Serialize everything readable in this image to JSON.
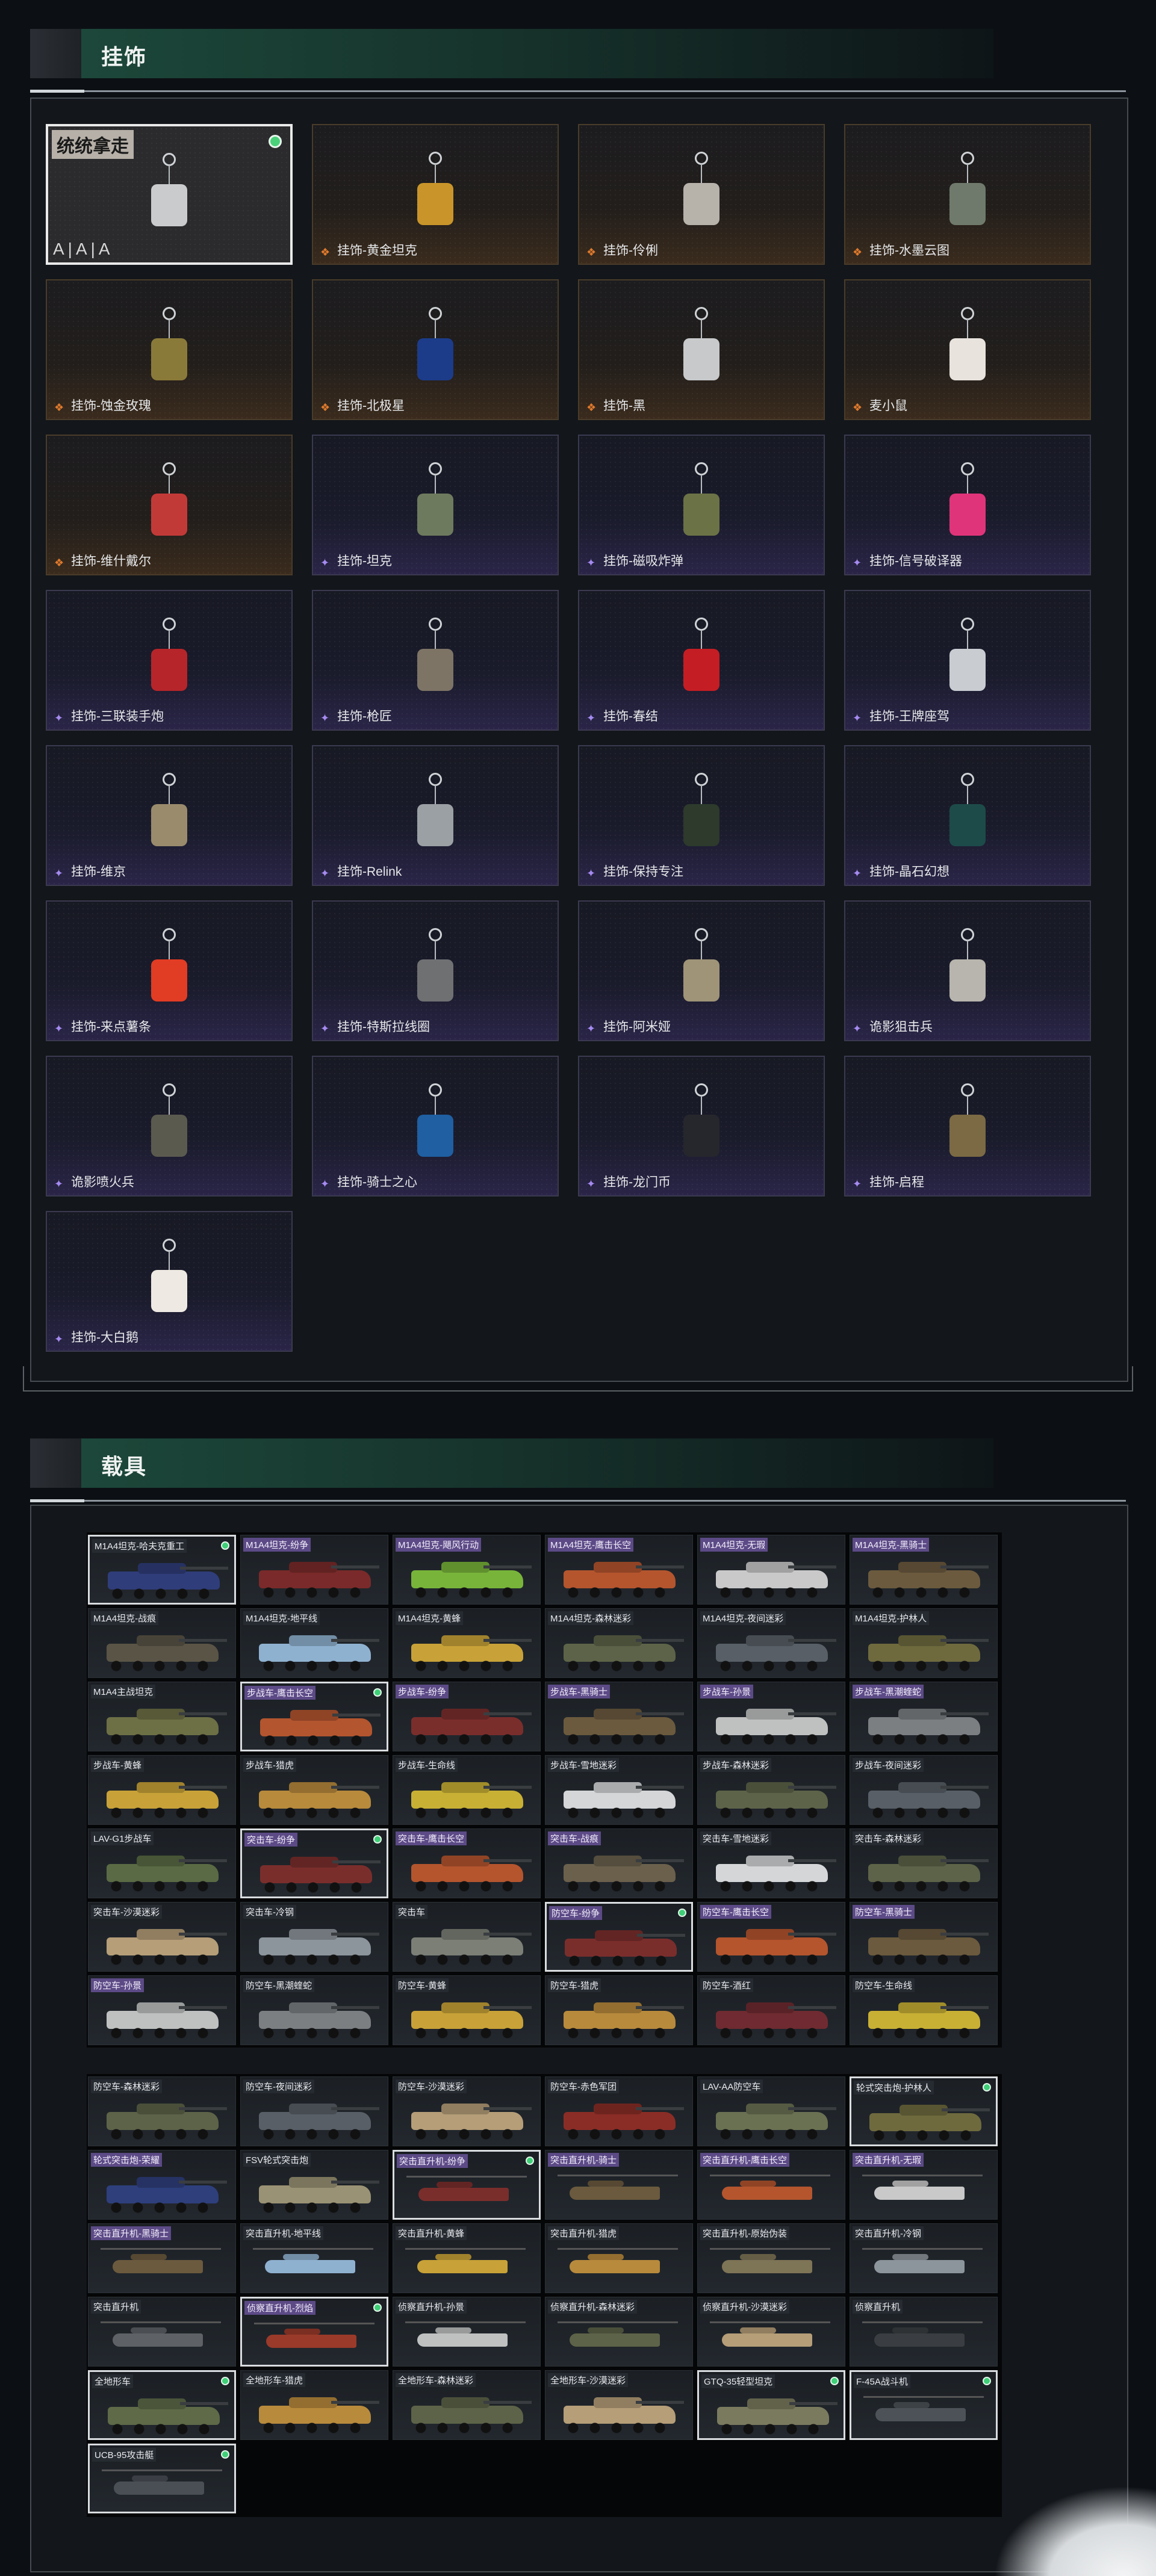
{
  "sections": {
    "charms": {
      "title": "挂饰",
      "items": [
        {
          "label": "统统拿走",
          "rarity": "selected",
          "badge": "统统拿走",
          "tier": "A|A|A",
          "owned": true,
          "color": "#c9cbcd"
        },
        {
          "label": "挂饰-黄金坦克",
          "rarity": "gold",
          "color": "#c9952a"
        },
        {
          "label": "挂饰-伶俐",
          "rarity": "gold",
          "color": "#b7b3ab"
        },
        {
          "label": "挂饰-水墨云图",
          "rarity": "gold",
          "color": "#6f7a6c"
        },
        {
          "label": "挂饰-蚀金玫瑰",
          "rarity": "gold",
          "color": "#8a7a3a"
        },
        {
          "label": "挂饰-北极星",
          "rarity": "gold",
          "color": "#1c3c8a"
        },
        {
          "label": "挂饰-黑",
          "rarity": "gold",
          "color": "#c7c9cb"
        },
        {
          "label": "麦小鼠",
          "rarity": "gold",
          "color": "#e9e3dd"
        },
        {
          "label": "挂饰-维什戴尔",
          "rarity": "gold",
          "color": "#c23a38"
        },
        {
          "label": "挂饰-坦克",
          "rarity": "purple",
          "color": "#6e7a5e"
        },
        {
          "label": "挂饰-磁吸炸弹",
          "rarity": "purple",
          "color": "#6b7246"
        },
        {
          "label": "挂饰-信号破译器",
          "rarity": "purple",
          "color": "#e0347a"
        },
        {
          "label": "挂饰-三联装手炮",
          "rarity": "purple",
          "color": "#b6252a"
        },
        {
          "label": "挂饰-枪匠",
          "rarity": "purple",
          "color": "#7d7466"
        },
        {
          "label": "挂饰-春结",
          "rarity": "purple",
          "color": "#c51d24"
        },
        {
          "label": "挂饰-王牌座驾",
          "rarity": "purple",
          "color": "#c9cdd2"
        },
        {
          "label": "挂饰-维京",
          "rarity": "purple",
          "color": "#9a8b6d"
        },
        {
          "label": "挂饰-Relink",
          "rarity": "purple",
          "color": "#9ba0a4"
        },
        {
          "label": "挂饰-保持专注",
          "rarity": "purple",
          "color": "#2d3a2c"
        },
        {
          "label": "挂饰-晶石幻想",
          "rarity": "purple",
          "color": "#1d4b4a"
        },
        {
          "label": "挂饰-来点薯条",
          "rarity": "purple",
          "color": "#e13c24"
        },
        {
          "label": "挂饰-特斯拉线圈",
          "rarity": "purple",
          "color": "#6f7072"
        },
        {
          "label": "挂饰-阿米娅",
          "rarity": "purple",
          "color": "#9f9478"
        },
        {
          "label": "诡影狙击兵",
          "rarity": "purple",
          "color": "#b8b5ae"
        },
        {
          "label": "诡影喷火兵",
          "rarity": "purple",
          "color": "#5b5a4f"
        },
        {
          "label": "挂饰-骑士之心",
          "rarity": "purple",
          "color": "#1f5fa2"
        },
        {
          "label": "挂饰-龙门币",
          "rarity": "purple",
          "color": "#25272c"
        },
        {
          "label": "挂饰-启程",
          "rarity": "purple",
          "color": "#7b6a44"
        },
        {
          "label": "挂饰-大白鹅",
          "rarity": "purple",
          "color": "#eee9e2"
        }
      ]
    },
    "vehicles": {
      "title": "载具",
      "group1": [
        {
          "label": "M1A4坦克-哈夫克重工",
          "hl": true,
          "dot": true,
          "color": "#2f3d7a",
          "tag": "dark"
        },
        {
          "label": "M1A4坦克-纷争",
          "color": "#7a2a2a",
          "tag": "purple"
        },
        {
          "label": "M1A4坦克-飓风行动",
          "color": "#78b43a",
          "tag": "purple"
        },
        {
          "label": "M1A4坦克-鹰击长空",
          "color": "#b4552e",
          "tag": "purple"
        },
        {
          "label": "M1A4坦克-无瑕",
          "color": "#c9c9c9",
          "tag": "purple"
        },
        {
          "label": "M1A4坦克-黑骑士",
          "color": "#6b5a3e",
          "tag": "purple"
        },
        {
          "label": "M1A4坦克-战痕",
          "color": "#5a5446",
          "tag": "dark"
        },
        {
          "label": "M1A4坦克-地平线",
          "color": "#8fb1d0",
          "tag": "dark"
        },
        {
          "label": "M1A4坦克-黄蜂",
          "color": "#c8a238",
          "tag": "dark"
        },
        {
          "label": "M1A4坦克-森林迷彩",
          "color": "#5d6348",
          "tag": "dark"
        },
        {
          "label": "M1A4坦克-夜间迷彩",
          "color": "#585f66",
          "tag": "dark"
        },
        {
          "label": "M1A4坦克-护林人",
          "color": "#6e6a3e",
          "tag": "dark"
        },
        {
          "label": "M1A4主战坦克",
          "color": "#6d6f45",
          "tag": "dark"
        },
        {
          "label": "步战车-鹰击长空",
          "hl": true,
          "dot": true,
          "color": "#b3552f",
          "tag": "purple"
        },
        {
          "label": "步战车-纷争",
          "color": "#7a2e2c",
          "tag": "purple"
        },
        {
          "label": "步战车-黑骑士",
          "color": "#6b5a3e",
          "tag": "purple"
        },
        {
          "label": "步战车-孙景",
          "color": "#bfc1c0",
          "tag": "purple"
        },
        {
          "label": "步战车-黑潮蝰蛇",
          "color": "#7c7f82",
          "tag": "purple"
        },
        {
          "label": "步战车-黄蜂",
          "color": "#c8a238",
          "tag": "dark"
        },
        {
          "label": "步战车-猎虎",
          "color": "#b88a3c",
          "tag": "dark"
        },
        {
          "label": "步战车-生命线",
          "color": "#c8b034",
          "tag": "dark"
        },
        {
          "label": "步战车-雪地迷彩",
          "color": "#d4d6d8",
          "tag": "dark"
        },
        {
          "label": "步战车-森林迷彩",
          "color": "#5d6348",
          "tag": "dark"
        },
        {
          "label": "步战车-夜间迷彩",
          "color": "#585f66",
          "tag": "dark"
        },
        {
          "label": "LAV-G1步战车",
          "color": "#5a6a44",
          "tag": "dark"
        },
        {
          "label": "突击车-纷争",
          "hl": true,
          "dot": true,
          "color": "#7a2e2c",
          "tag": "purple"
        },
        {
          "label": "突击车-鹰击长空",
          "color": "#b4552e",
          "tag": "purple"
        },
        {
          "label": "突击车-战痕",
          "color": "#6a604c",
          "tag": "purple"
        },
        {
          "label": "突击车-雪地迷彩",
          "color": "#d4d6d8",
          "tag": "dark"
        },
        {
          "label": "突击车-森林迷彩",
          "color": "#5d6348",
          "tag": "dark"
        },
        {
          "label": "突击车-沙漠迷彩",
          "color": "#b59e78",
          "tag": "dark"
        },
        {
          "label": "突击车-冷钢",
          "color": "#8d959c",
          "tag": "dark"
        },
        {
          "label": "突击车",
          "color": "#7b7f76",
          "tag": "dark"
        },
        {
          "label": "防空车-纷争",
          "hl": true,
          "dot": true,
          "color": "#7a2e2c",
          "tag": "purple"
        },
        {
          "label": "防空车-鹰击长空",
          "color": "#b4552e",
          "tag": "purple"
        },
        {
          "label": "防空车-黑骑士",
          "color": "#6b5a3e",
          "tag": "purple"
        },
        {
          "label": "防空车-孙景",
          "color": "#bfc1c0",
          "tag": "purple"
        },
        {
          "label": "防空车-黑潮蝰蛇",
          "color": "#7c7f82",
          "tag": "dark"
        },
        {
          "label": "防空车-黄蜂",
          "color": "#c8a238",
          "tag": "dark"
        },
        {
          "label": "防空车-猎虎",
          "color": "#b88a3c",
          "tag": "dark"
        },
        {
          "label": "防空车-酒红",
          "color": "#6f2b31",
          "tag": "dark"
        },
        {
          "label": "防空车-生命线",
          "color": "#c8b034",
          "tag": "dark"
        }
      ],
      "group2": [
        {
          "label": "防空车-森林迷彩",
          "color": "#5d6348",
          "tag": "dark"
        },
        {
          "label": "防空车-夜间迷彩",
          "color": "#585f66",
          "tag": "dark"
        },
        {
          "label": "防空车-沙漠迷彩",
          "color": "#b59e78",
          "tag": "dark"
        },
        {
          "label": "防空车-赤色军团",
          "color": "#8a2d26",
          "tag": "dark"
        },
        {
          "label": "LAV-AA防空车",
          "color": "#6a7152",
          "tag": "dark"
        },
        {
          "label": "轮式突击炮-护林人",
          "hl": true,
          "dot": true,
          "color": "#6e6a3e",
          "tag": "dark"
        },
        {
          "label": "轮式突击炮-荣耀",
          "color": "#2e3f7c",
          "tag": "purple"
        },
        {
          "label": "FSV轮式突击炮",
          "color": "#9a9274",
          "tag": "dark"
        },
        {
          "label": "突击直升机-纷争",
          "hl": true,
          "dot": true,
          "color": "#7a2e2c",
          "tag": "purple",
          "heli": true
        },
        {
          "label": "突击直升机-骑士",
          "color": "#6b5a3e",
          "tag": "purple",
          "heli": true
        },
        {
          "label": "突击直升机-鹰击长空",
          "color": "#b4552e",
          "tag": "purple",
          "heli": true
        },
        {
          "label": "突击直升机-无瑕",
          "color": "#c9c9c9",
          "tag": "purple",
          "heli": true
        },
        {
          "label": "突击直升机-黑骑士",
          "color": "#6b5a3e",
          "tag": "purple",
          "heli": true
        },
        {
          "label": "突击直升机-地平线",
          "color": "#8fb1d0",
          "tag": "dark",
          "heli": true
        },
        {
          "label": "突击直升机-黄蜂",
          "color": "#c8a238",
          "tag": "dark",
          "heli": true
        },
        {
          "label": "突击直升机-猎虎",
          "color": "#b88a3c",
          "tag": "dark",
          "heli": true
        },
        {
          "label": "突击直升机-原始伪装",
          "color": "#7e7456",
          "tag": "dark",
          "heli": true
        },
        {
          "label": "突击直升机-冷钢",
          "color": "#8d959c",
          "tag": "dark",
          "heli": true
        },
        {
          "label": "突击直升机",
          "color": "#5e6266",
          "tag": "dark",
          "heli": true
        },
        {
          "label": "侦察直升机-烈焰",
          "hl": true,
          "dot": true,
          "color": "#9a3a2a",
          "tag": "purple",
          "heli": true
        },
        {
          "label": "侦察直升机-孙景",
          "color": "#bfc1c0",
          "tag": "dark",
          "heli": true
        },
        {
          "label": "侦察直升机-森林迷彩",
          "color": "#5d6348",
          "tag": "dark",
          "heli": true
        },
        {
          "label": "侦察直升机-沙漠迷彩",
          "color": "#b59e78",
          "tag": "dark",
          "heli": true
        },
        {
          "label": "侦察直升机",
          "color": "#3a3e42",
          "tag": "dark",
          "heli": true
        },
        {
          "label": "全地形车",
          "hl": true,
          "dot": true,
          "color": "#5e6a48",
          "tag": "dark"
        },
        {
          "label": "全地形车-猎虎",
          "color": "#b88a3c",
          "tag": "dark"
        },
        {
          "label": "全地形车-森林迷彩",
          "color": "#5d6348",
          "tag": "dark"
        },
        {
          "label": "全地形车-沙漠迷彩",
          "color": "#b59e78",
          "tag": "dark"
        },
        {
          "label": "GTQ-35轻型坦克",
          "hl": true,
          "dot": true,
          "color": "#7a7b5e",
          "tag": "dark"
        },
        {
          "label": "F-45A战斗机",
          "hl": true,
          "dot": true,
          "color": "#4c5257",
          "tag": "dark",
          "heli": true
        },
        {
          "label": "UCB-95攻击艇",
          "hl": true,
          "dot": true,
          "color": "#4a4f56",
          "tag": "dark",
          "heli": true
        }
      ]
    }
  }
}
